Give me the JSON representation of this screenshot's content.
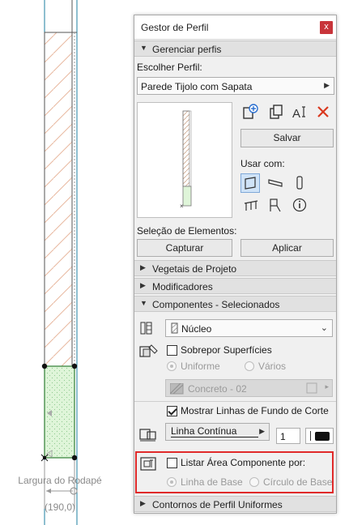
{
  "canvas": {
    "bottom_label": "Largura do Rodapé",
    "dimension_label": "(190,0)"
  },
  "palette": {
    "title": "Gestor de Perfil",
    "close_glyph": "x",
    "sections": {
      "manage": "Gerenciar perfis",
      "vegetais": "Vegetais de Projeto",
      "modificadores": "Modificadores",
      "componentes": "Componentes - Selecionados",
      "contornos": "Contornos de Perfil Uniformes"
    },
    "choose_profile_label": "Escolher Perfil:",
    "profile_value": "Parede Tijolo com Sapata",
    "save_button": "Salvar",
    "use_with_label": "Usar com:",
    "selection_label": "Seleção de Elementos:",
    "capture_button": "Capturar",
    "apply_button": "Aplicar",
    "component_value": "Núcleo",
    "override_surfaces_label": "Sobrepor Superfícies",
    "uniform_label": "Uniforme",
    "various_label": "Vários",
    "surface_value": "Concreto - 02",
    "show_lines_label": "Mostrar Linhas de Fundo de Corte",
    "line_type_value": "Linha Contínua",
    "pen_number": "1",
    "list_area_label": "Listar Área Componente por:",
    "baseline_label": "Linha de Base",
    "base_circle_label": "Círculo de Base"
  },
  "colors": {
    "accent_red": "#e02a2a",
    "close_red": "#c8343a",
    "selected_icon_bg": "#cfe3f8",
    "core_fill": "#dff5d9",
    "hatch": "#e8b8a0"
  },
  "icons": {
    "collapse": "triangle-down",
    "expand": "triangle-right"
  }
}
